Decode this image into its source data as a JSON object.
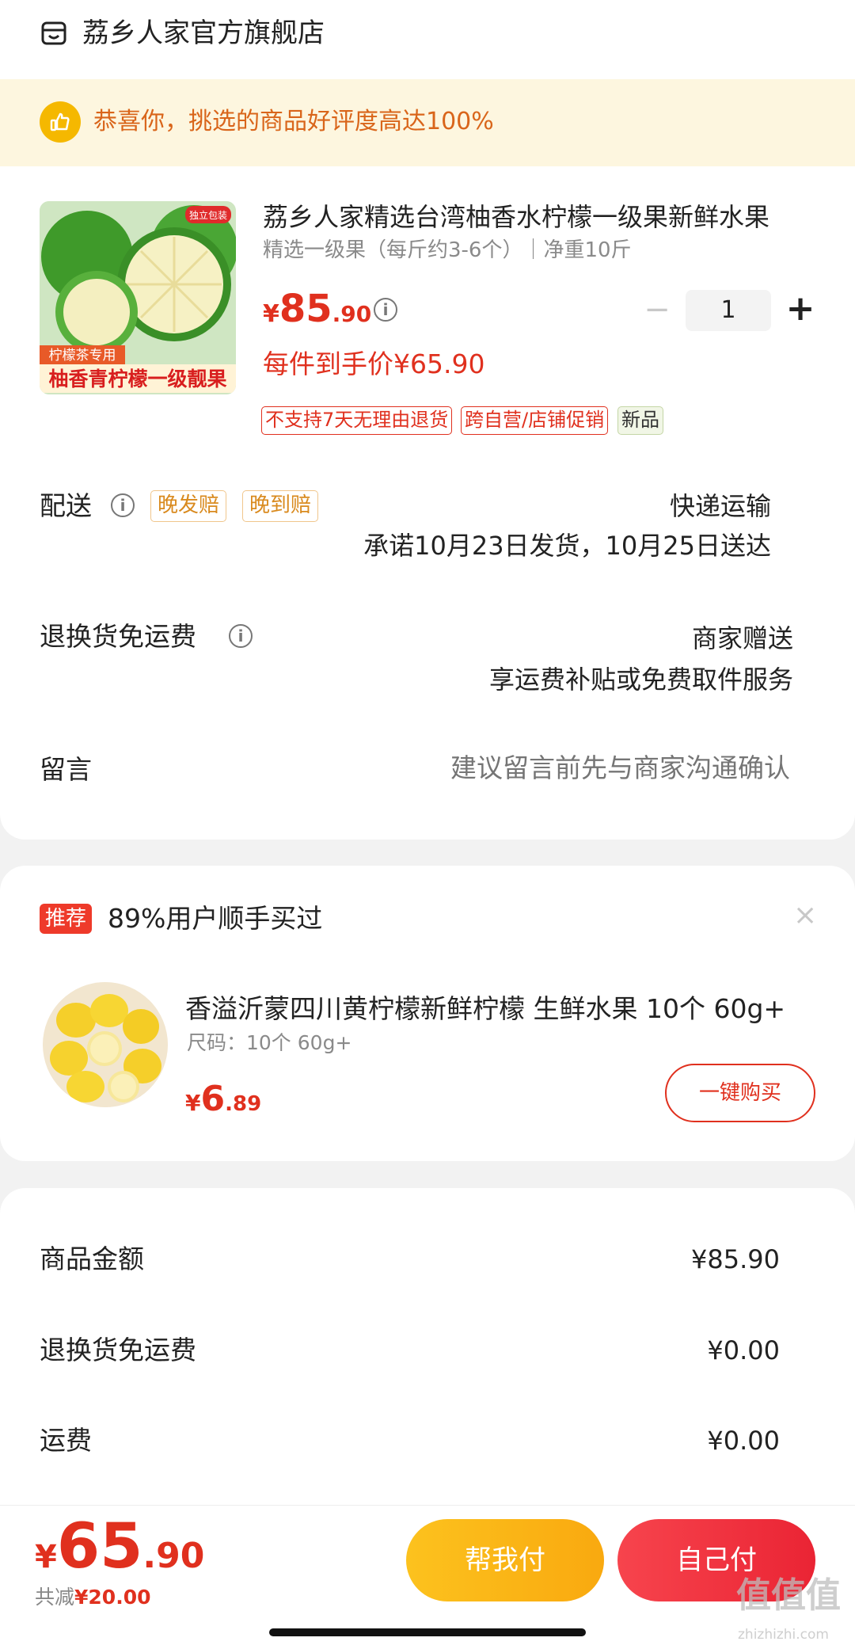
{
  "shop": {
    "name": "荔乡人家官方旗舰店",
    "icon": "shop-icon"
  },
  "banner": {
    "text": "恭喜你，挑选的商品好评度高达100%",
    "icon": "thumbs-up-icon"
  },
  "product": {
    "image_top_badge": "独立包装",
    "image_caption_1": "柠檬茶专用",
    "image_caption_2": "柚香青柠檬一级靓果",
    "title": "荔乡人家精选台湾柚香水柠檬一级果新鲜水果",
    "spec": "精选一级果（每斤约3-6个）｜净重10斤",
    "price_currency": "¥",
    "price_int": "85",
    "price_dec": ".90",
    "quantity": "1",
    "qty_minus": "−",
    "qty_plus": "+",
    "net_price": "每件到手价¥65.90",
    "tags": [
      "不支持7天无理由退货",
      "跨自营/店铺促销",
      "新品"
    ]
  },
  "delivery": {
    "label": "配送",
    "tags": [
      "晚发赔",
      "晚到赔"
    ],
    "method": "快递运输",
    "promise": "承诺10月23日发货，10月25日送达"
  },
  "return_shipping": {
    "label": "退换货免运费",
    "value1": "商家赠送",
    "value2": "享运费补贴或免费取件服务"
  },
  "message": {
    "label": "留言",
    "placeholder": "建议留言前先与商家沟通确认"
  },
  "recommend": {
    "badge": "推荐",
    "title": "89%用户顺手买过",
    "close": "×",
    "name": "香溢沂蒙四川黄柠檬新鲜柠檬  生鲜水果 10个 60g+",
    "size": "尺码：10个 60g+",
    "price_currency": "¥",
    "price_int": "6",
    "price_dec": ".89",
    "buy_label": "一键购买"
  },
  "summary": {
    "rows": [
      {
        "label": "商品金额",
        "value": "¥85.90"
      },
      {
        "label": "退换货免运费",
        "value": "¥0.00"
      },
      {
        "label": "运费",
        "value": "¥0.00"
      }
    ]
  },
  "checkout": {
    "currency": "¥",
    "total_int": "65",
    "total_dec": ".90",
    "discount_label": "共减",
    "discount_value": "¥20.00",
    "help_pay": "帮我付",
    "self_pay": "自己付"
  },
  "watermark": {
    "text": "值值值",
    "url": "zhizhizhi.com"
  },
  "colors": {
    "accent_red": "#e0301e",
    "orange": "#d9651a",
    "yellow_btn": "#fcc21e",
    "red_btn": "#ea2434"
  }
}
